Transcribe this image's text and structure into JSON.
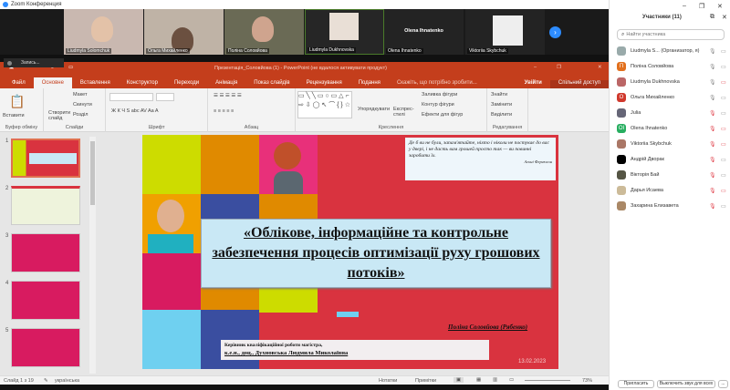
{
  "zoom": {
    "title": "Zoom Конференция",
    "recording": "Запись...",
    "next_icon": "chevron-right-icon"
  },
  "videos": [
    {
      "name": "Liudmyla Solomchuk"
    },
    {
      "name": "Ольга Михайленко"
    },
    {
      "name": "Поліна Соловйова"
    },
    {
      "name": "Liudmyla Dukhnovska"
    },
    {
      "name": "Olena Ihnatenko",
      "center_label": "Olena Ihnatenko"
    },
    {
      "name": "Viktoriia Skybchuk"
    }
  ],
  "ppt": {
    "window_title": "Презентація_Соловйова (1) - PowerPoint (не вдалося активувати продукт)",
    "tabs": [
      "Файл",
      "Основне",
      "Вставлення",
      "Конструктор",
      "Переходи",
      "Анімація",
      "Показ слайдів",
      "Рецензування",
      "Подання"
    ],
    "tell_me": "Скажіть, що потрібно зробити...",
    "sign_in": "Увійти",
    "share": "Спільний доступ",
    "ribbon": {
      "paste": "Вставити",
      "new_slide": "Створити слайд",
      "layout": "Макет",
      "reset": "Скинути",
      "section": "Розділ",
      "arrange": "Упорядкувати",
      "quick_styles": "Експрес-стилі",
      "shape_fill": "Заливка фігури",
      "shape_outline": "Контур фігури",
      "shape_effects": "Ефекти для фігур",
      "find": "Знайти",
      "replace": "Замінити",
      "select": "Виділити",
      "groups": [
        "Буфер обміну",
        "Слайди",
        "Шрифт",
        "Абзац",
        "Креслення",
        "Редагування"
      ]
    },
    "thumb_numbers": [
      "1",
      "2",
      "3",
      "4",
      "5"
    ],
    "slide": {
      "quote": "Де б ви не були, запам'ятайте, ніхто і ніколи не постукає до вас у двері, і не дасть вам грошей просто так — ви повинні заробити їх.",
      "quote_author": "Агоні Фергюсон",
      "title": "«Облікове, інформаційне та контрольне забезпечення процесів оптимізації руху грошових потоків»",
      "author": "Поліна Соловйова (Рябенко)",
      "supervisor_line1": "Керівник кваліфікаційної роботи магістра,",
      "supervisor_line2": "к.е.н., доц., Духновська Людмила Миколаївна",
      "date": "13.02.2023"
    },
    "status": {
      "slide": "Слайд 1 з 19",
      "language": "українська",
      "notes": "Нотатки",
      "comments": "Примітки",
      "zoom": "73%"
    }
  },
  "participants": {
    "title": "Участники (11)",
    "search_placeholder": "Найти участника",
    "list": [
      {
        "name": "Liudmyla S... (Организатор, я)",
        "color": "#9aa",
        "mic": "on",
        "cam": "on"
      },
      {
        "name": "Поліна Соловйова",
        "initial": "П",
        "color": "#e2701d",
        "mic": "on",
        "cam": "on"
      },
      {
        "name": "Liudmyla Dukhnovska",
        "color": "#b66",
        "mic": "on",
        "cam": "off"
      },
      {
        "name": "Ольга Михайленко",
        "initial": "О",
        "color": "#d0392d",
        "mic": "on",
        "cam": "on"
      },
      {
        "name": "Julia",
        "color": "#667",
        "mic": "off",
        "cam": "on"
      },
      {
        "name": "Olena Ihnatenko",
        "initial": "OI",
        "color": "#27ae60",
        "mic": "off",
        "cam": "off"
      },
      {
        "name": "Viktoriia Skybchuk",
        "color": "#a76",
        "mic": "off",
        "cam": "off"
      },
      {
        "name": "Андрій Дворак",
        "color": "#000",
        "mic": "off",
        "cam": "on"
      },
      {
        "name": "Вікторія Бай",
        "color": "#554",
        "mic": "off",
        "cam": "on"
      },
      {
        "name": "Дарья Исаева",
        "color": "#cb9",
        "mic": "off",
        "cam": "off"
      },
      {
        "name": "Захарина Елизавета",
        "color": "#a86",
        "mic": "off",
        "cam": "on"
      }
    ],
    "invite": "Пригласить",
    "mute_all": "Выключить звук для всех",
    "more": "..."
  }
}
